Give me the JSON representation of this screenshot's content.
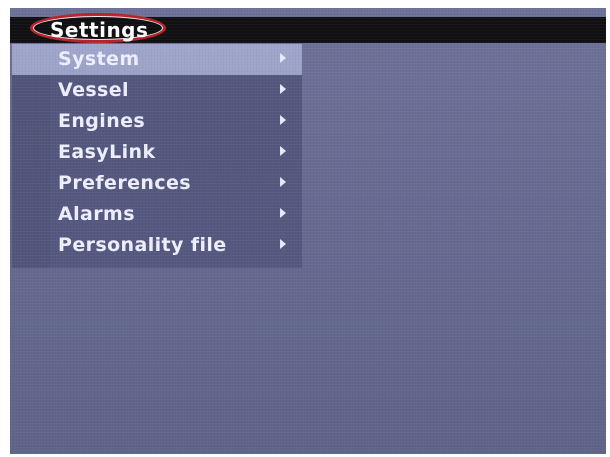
{
  "window": {
    "title": "Settings"
  },
  "menu": {
    "selected_index": 0,
    "items": [
      {
        "label": "System",
        "icon": "chevron-right-icon"
      },
      {
        "label": "Vessel",
        "icon": "chevron-right-icon"
      },
      {
        "label": "Engines",
        "icon": "chevron-right-icon"
      },
      {
        "label": "EasyLink",
        "icon": "chevron-right-icon"
      },
      {
        "label": "Preferences",
        "icon": "chevron-right-icon"
      },
      {
        "label": "Alarms",
        "icon": "chevron-right-icon"
      },
      {
        "label": "Personality file",
        "icon": "chevron-right-icon"
      }
    ]
  },
  "colors": {
    "background": "#676b92",
    "menu_panel": "#555980",
    "selected_item": "#9fa5ca",
    "title_bar": "#111114",
    "highlight_oval": "#b8242a",
    "text": "#eef0ff"
  }
}
